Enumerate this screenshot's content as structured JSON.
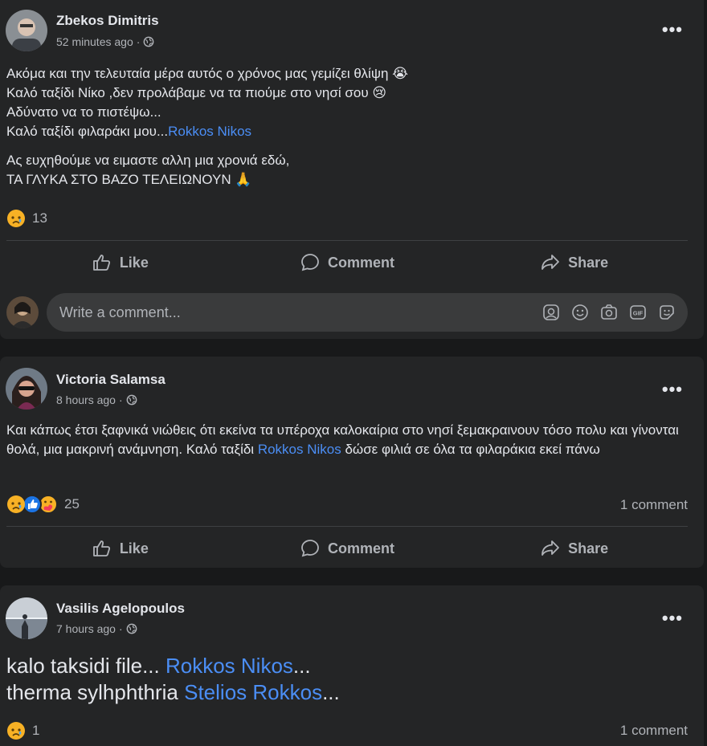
{
  "posts": [
    {
      "author": "Zbekos Dimitris",
      "time": "52 minutes ago",
      "more": "•••",
      "lines": [
        {
          "text": "Ακόμα και την τελευταία μέρα αυτός ο χρόνος μας γεμίζει θλίψη 😭"
        },
        {
          "text": "Καλό ταξίδι Νίκο ,δεν προλάβαμε να τα πιούμε στο νησί σου 😢"
        },
        {
          "text": "Αδύνατο να το πιστέψω..."
        },
        {
          "text": "Καλό ταξίδι φιλαράκι μου...",
          "mention": "Rokkos Nikos"
        }
      ],
      "lines2": [
        {
          "text": "Ας ευχηθούμε να ειμαστε αλλη μια χρονιά εδώ,"
        },
        {
          "text": "ΤΑ ΓΛΥΚΑ ΣΤΟ ΒΑΖΟ ΤΕΛΕΙΩΝΟΥΝ 🙏"
        }
      ],
      "reaction_count": "13",
      "comment_count": ""
    },
    {
      "author": "Victoria Salamsa",
      "time": "8 hours ago",
      "more": "•••",
      "text_before": "Και κάπως έτσι ξαφνικά νιώθεις ότι εκείνα τα υπέροχα καλοκαίρια στο νησί ξεμακραινουν τόσο πολυ και γίνονται θολά, μια μακρινή ανάμνηση. Καλό ταξίδι ",
      "mention": "Rokkos Nikos",
      "text_after": " δώσε φιλιά σε όλα τα φιλαράκια εκεί πάνω",
      "reaction_count": "25",
      "comment_count": "1 comment"
    },
    {
      "author": "Vasilis Agelopoulos",
      "time": "7 hours ago",
      "more": "•••",
      "line1_text": "kalo taksidi file... ",
      "line1_mention": "Rokkos Nikos",
      "line1_tail": "...",
      "line2_text": "therma sylhphthria ",
      "line2_mention": "Stelios Rokkos",
      "line2_tail": "...",
      "reaction_count": "1",
      "comment_count": "1 comment"
    }
  ],
  "actions": {
    "like": "Like",
    "comment": "Comment",
    "share": "Share"
  },
  "composer": {
    "placeholder": "Write a comment..."
  },
  "colors": {
    "bg": "#18191a",
    "card": "#242526",
    "mention": "#4b8ef5",
    "muted": "#b0b3b8"
  }
}
